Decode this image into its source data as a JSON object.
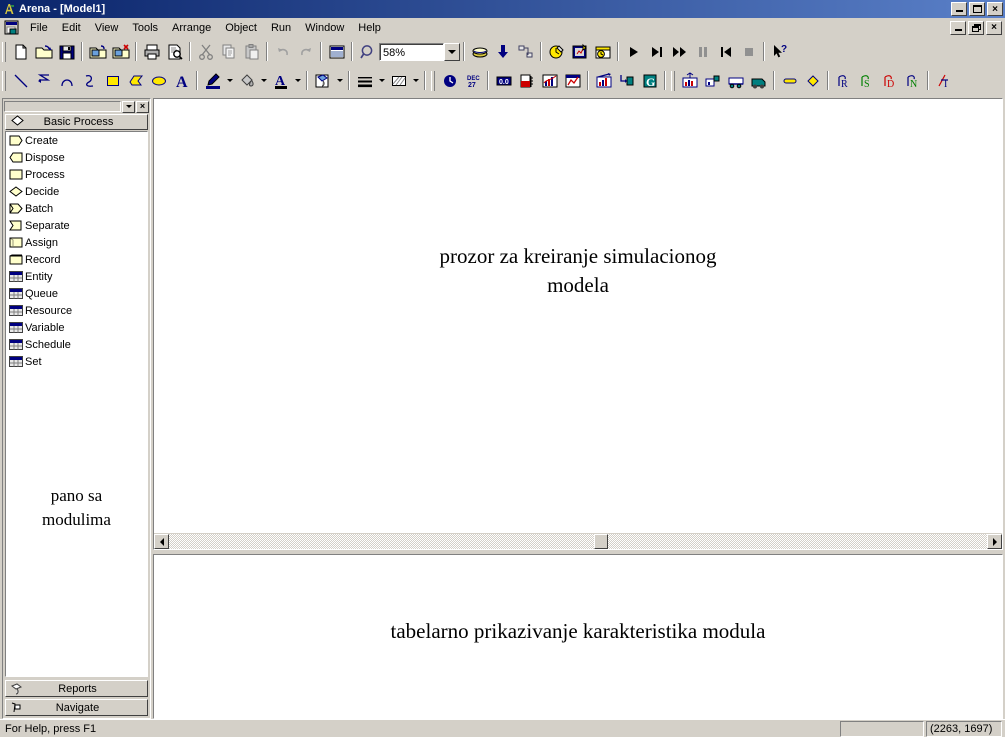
{
  "window": {
    "title": "Arena - [Model1]",
    "app_icon": "arena-icon",
    "buttons": {
      "minimize": "minimize",
      "maximize": "maximize",
      "close": "close"
    }
  },
  "menu": {
    "doc_icon": "document-window-icon",
    "items": [
      "File",
      "Edit",
      "View",
      "Tools",
      "Arrange",
      "Object",
      "Run",
      "Window",
      "Help"
    ],
    "child_buttons": {
      "minimize": "minimize",
      "restore": "restore",
      "close": "close"
    }
  },
  "toolbar_standard": {
    "icons": [
      "new-file-icon",
      "open-folder-icon",
      "save-icon",
      "open-template-icon",
      "close-template-icon",
      "print-icon",
      "print-preview-icon",
      "cut-icon",
      "copy-icon",
      "paste-icon",
      "undo-icon",
      "redo-icon",
      "view-window-icon"
    ],
    "zoom": {
      "label": "zoom-icon",
      "value": "58%",
      "placeholder": "58%"
    },
    "icons2": [
      "layers-icon",
      "submodel-down-icon",
      "connect-icon",
      "run-setup-icon",
      "animate-connectors-icon",
      "time-icon"
    ],
    "run_controls": [
      "play-icon",
      "step-icon",
      "fast-forward-icon",
      "pause-icon",
      "start-over-icon",
      "stop-icon"
    ],
    "help_icon": "help-pointer-icon"
  },
  "toolbar_draw": {
    "draw_icons": [
      "line-icon",
      "polyline-icon",
      "arc-icon",
      "bezier-icon",
      "box-icon",
      "polygon-icon",
      "ellipse-icon",
      "text-icon"
    ],
    "style_icons": [
      "line-color-icon",
      "fill-color-icon",
      "text-color-icon",
      "window-background-icon",
      "line-width-icon",
      "fill-pattern-icon"
    ],
    "animate_icons": [
      "clock-icon",
      "date-icon"
    ],
    "animate_icons2": [
      "variable-icon",
      "level-icon",
      "plot-icon",
      "histogram-icon"
    ],
    "animate_icons3": [
      "chart-icon",
      "flowchart-icon",
      "global-icon"
    ],
    "transfer_icons": [
      "station-icon",
      "route-icon",
      "segment-icon",
      "transporter-icon"
    ],
    "shape_icons": [
      "entity-picture-icon",
      "resource-picture-icon"
    ],
    "report_icons": [
      "report-r-icon",
      "report-s-icon",
      "report-d-icon",
      "report-n-icon"
    ],
    "last_icon": "transfer-icon"
  },
  "project_bar": {
    "panel_title": "Basic Process",
    "panel_icon": "decide-diamond-icon",
    "modules": [
      {
        "label": "Create",
        "icon": "create-module-icon",
        "type": "flowchart"
      },
      {
        "label": "Dispose",
        "icon": "dispose-module-icon",
        "type": "flowchart"
      },
      {
        "label": "Process",
        "icon": "process-module-icon",
        "type": "flowchart"
      },
      {
        "label": "Decide",
        "icon": "decide-module-icon",
        "type": "flowchart"
      },
      {
        "label": "Batch",
        "icon": "batch-module-icon",
        "type": "flowchart"
      },
      {
        "label": "Separate",
        "icon": "separate-module-icon",
        "type": "flowchart"
      },
      {
        "label": "Assign",
        "icon": "assign-module-icon",
        "type": "flowchart"
      },
      {
        "label": "Record",
        "icon": "record-module-icon",
        "type": "flowchart"
      },
      {
        "label": "Entity",
        "icon": "entity-data-icon",
        "type": "data"
      },
      {
        "label": "Queue",
        "icon": "queue-data-icon",
        "type": "data"
      },
      {
        "label": "Resource",
        "icon": "resource-data-icon",
        "type": "data"
      },
      {
        "label": "Variable",
        "icon": "variable-data-icon",
        "type": "data"
      },
      {
        "label": "Schedule",
        "icon": "schedule-data-icon",
        "type": "data"
      },
      {
        "label": "Set",
        "icon": "set-data-icon",
        "type": "data"
      }
    ],
    "annotation": "pano sa\nmodulima",
    "annotation_line1": "pano sa",
    "annotation_line2": "modulima",
    "buttons": [
      {
        "label": "Reports",
        "icon": "reports-icon"
      },
      {
        "label": "Navigate",
        "icon": "navigate-icon"
      }
    ]
  },
  "model_window": {
    "annotation_line1": "prozor za kreiranje simulacionog",
    "annotation_line2": "modela",
    "scrollbar": {
      "left_arrow": "scroll-left-icon",
      "right_arrow": "scroll-right-icon"
    }
  },
  "spreadsheet_window": {
    "annotation": "tabelarno prikazivanje karakteristika modula"
  },
  "status_bar": {
    "message": "For Help, press F1",
    "blank_cell": "",
    "coordinates": "(2263, 1697)"
  },
  "colors": {
    "titlebar_start": "#0a246a",
    "titlebar_end": "#5a80c8",
    "face": "#d4d0c8",
    "module_yellow": "#ffffcc",
    "icon_blue": "#000080",
    "accent_teal": "#008080"
  }
}
